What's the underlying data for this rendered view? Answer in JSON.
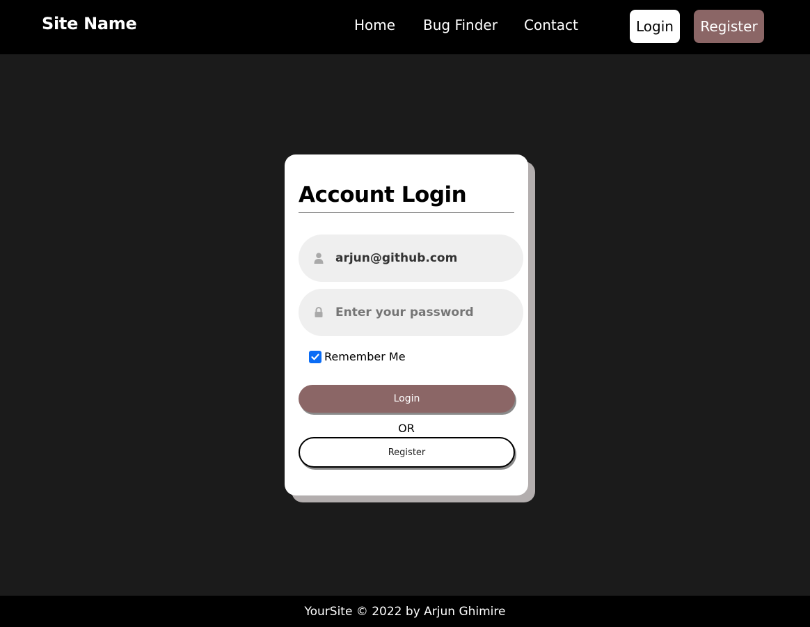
{
  "header": {
    "brand": "Site Name",
    "nav": {
      "home": "Home",
      "bug_finder": "Bug Finder",
      "contact": "Contact"
    },
    "login_button": "Login",
    "register_button": "Register"
  },
  "login_card": {
    "title": "Account Login",
    "email": {
      "value": "arjun@github.com",
      "icon": "user-icon"
    },
    "password": {
      "value": "",
      "placeholder": "Enter your password",
      "icon": "lock-icon"
    },
    "remember_me": {
      "label": "Remember Me",
      "checked": true
    },
    "login_button": "Login",
    "or_text": "OR",
    "register_button": "Register"
  },
  "footer": {
    "text": "YourSite © 2022 by Arjun Ghimire"
  },
  "colors": {
    "page_background": "#1b1b1b",
    "header_background": "#000000",
    "accent": "#8b6666",
    "card_shadow": "#b3aeae",
    "input_background": "#efefef",
    "checkbox": "#0a6cf5"
  }
}
